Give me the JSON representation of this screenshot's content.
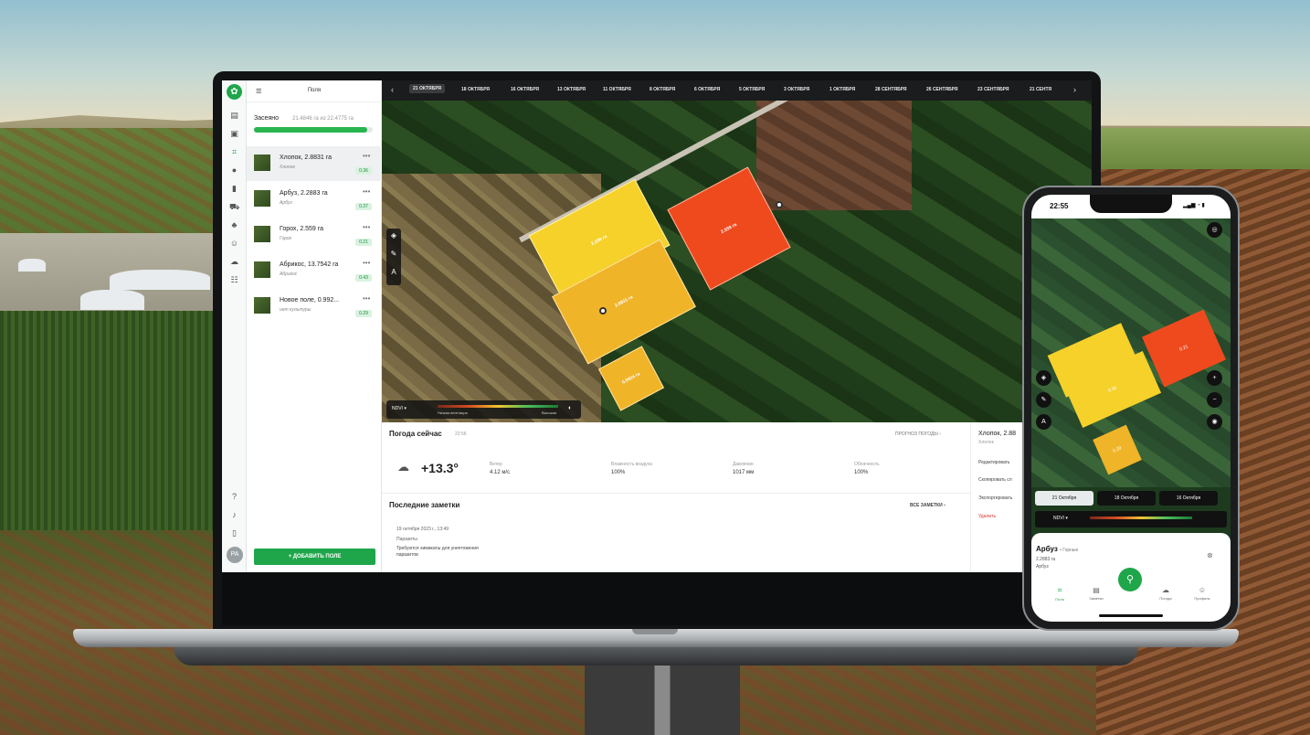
{
  "app": {
    "rail_logo_icon": "leaf-icon",
    "panel_title": "Поля",
    "sown_label": "Засеяно",
    "sown_value": "21.4846 га из 22.4775 га",
    "sown_progress_fraction": 0.955,
    "add_field_label": "+ ДОБАВИТЬ ПОЛЕ",
    "avatar_initials": "PA",
    "rail_help": "?"
  },
  "fields": [
    {
      "name": "Хлопок, 2.8831 га",
      "crop": "Хлопок",
      "ndvi": "0.36"
    },
    {
      "name": "Арбуз, 2.2883 га",
      "crop": "Арбуз",
      "ndvi": "0.37"
    },
    {
      "name": "Горох, 2.559 га",
      "crop": "Горох",
      "ndvi": "0.21"
    },
    {
      "name": "Абрикос, 13.7542 га",
      "crop": "Абрикос",
      "ndvi": "0.43"
    },
    {
      "name": "Новое поле, 0.992...",
      "crop": "нет культуры",
      "ndvi": "0.29"
    }
  ],
  "timeline": {
    "dates": [
      "21 ОКТЯБРЯ",
      "18 ОКТЯБРЯ",
      "16 ОКТЯБРЯ",
      "13 ОКТЯБРЯ",
      "11 ОКТЯБРЯ",
      "8 ОКТЯБРЯ",
      "6 ОКТЯБРЯ",
      "5 ОКТЯБРЯ",
      "3 ОКТЯБРЯ",
      "1 ОКТЯБРЯ",
      "28 СЕНТЯБРЯ",
      "26 СЕНТЯБРЯ",
      "23 СЕНТЯБРЯ",
      "21 СЕНТЯ"
    ]
  },
  "map": {
    "plots": [
      {
        "label": "2.288 га",
        "color": "#f6d12a"
      },
      {
        "label": "2.559 га",
        "color": "#ef4a1d"
      },
      {
        "label": "2.8831 га",
        "color": "#f0b428"
      },
      {
        "label": "0.9924 га",
        "color": "#f0b428"
      }
    ],
    "legend_index": "NDVI ▾",
    "legend_low": "Низкая вегетация",
    "legend_high": "Высокая"
  },
  "weather": {
    "title": "Погода сейчас",
    "time": "22:56",
    "forecast_link": "ПРОГНОЗ ПОГОДЫ ›",
    "temperature": "+13.3°",
    "stats": [
      {
        "label": "Ветер",
        "value": "4.12 м/с"
      },
      {
        "label": "Влажность воздуха",
        "value": "100%"
      },
      {
        "label": "Давление",
        "value": "1017 мм"
      },
      {
        "label": "Облачность",
        "value": "100%"
      }
    ]
  },
  "notes": {
    "title": "Последние заметки",
    "all_link": "ВСЕ ЗАМЕТКИ ›",
    "item": {
      "date": "19 октября 2023 г., 13:49",
      "type": "Паразиты",
      "text": "Требуются химикаты для уничтожения паразитов"
    }
  },
  "side_detail": {
    "title": "Хлопок, 2.88",
    "crop": "Хлопок",
    "actions": [
      "Редактировать",
      "Скопировать сл",
      "Экспортировать",
      "Удалить"
    ]
  },
  "phone": {
    "time": "22:55",
    "status_icons": "▂▄▆ ◔ ▮",
    "plots": [
      {
        "label": "",
        "color": "#f6d12a"
      },
      {
        "label": "0.21",
        "color": "#ef4a1d"
      },
      {
        "label": "0.36",
        "color": "#f6d12a"
      },
      {
        "label": "0.29",
        "color": "#f0b428"
      }
    ],
    "dates": [
      "21 Октября",
      "18 Октября",
      "16 Октября"
    ],
    "legend_index": "NDVI ▾",
    "sheet_title": "Арбуз",
    "sheet_subtitle": "• Горные",
    "sheet_area": "2.2883 га",
    "sheet_crop": "Арбуз",
    "nav": [
      {
        "label": "Поля",
        "icon": "fields-icon"
      },
      {
        "label": "Заметки",
        "icon": "notes-icon"
      },
      {
        "label": "Погода",
        "icon": "weather-icon"
      },
      {
        "label": "Профиль",
        "icon": "profile-icon"
      }
    ]
  },
  "colors": {
    "brand_green": "#1fa64a",
    "ndvi_high": "#1b7a34",
    "ndvi_low": "#7a2a1a"
  }
}
